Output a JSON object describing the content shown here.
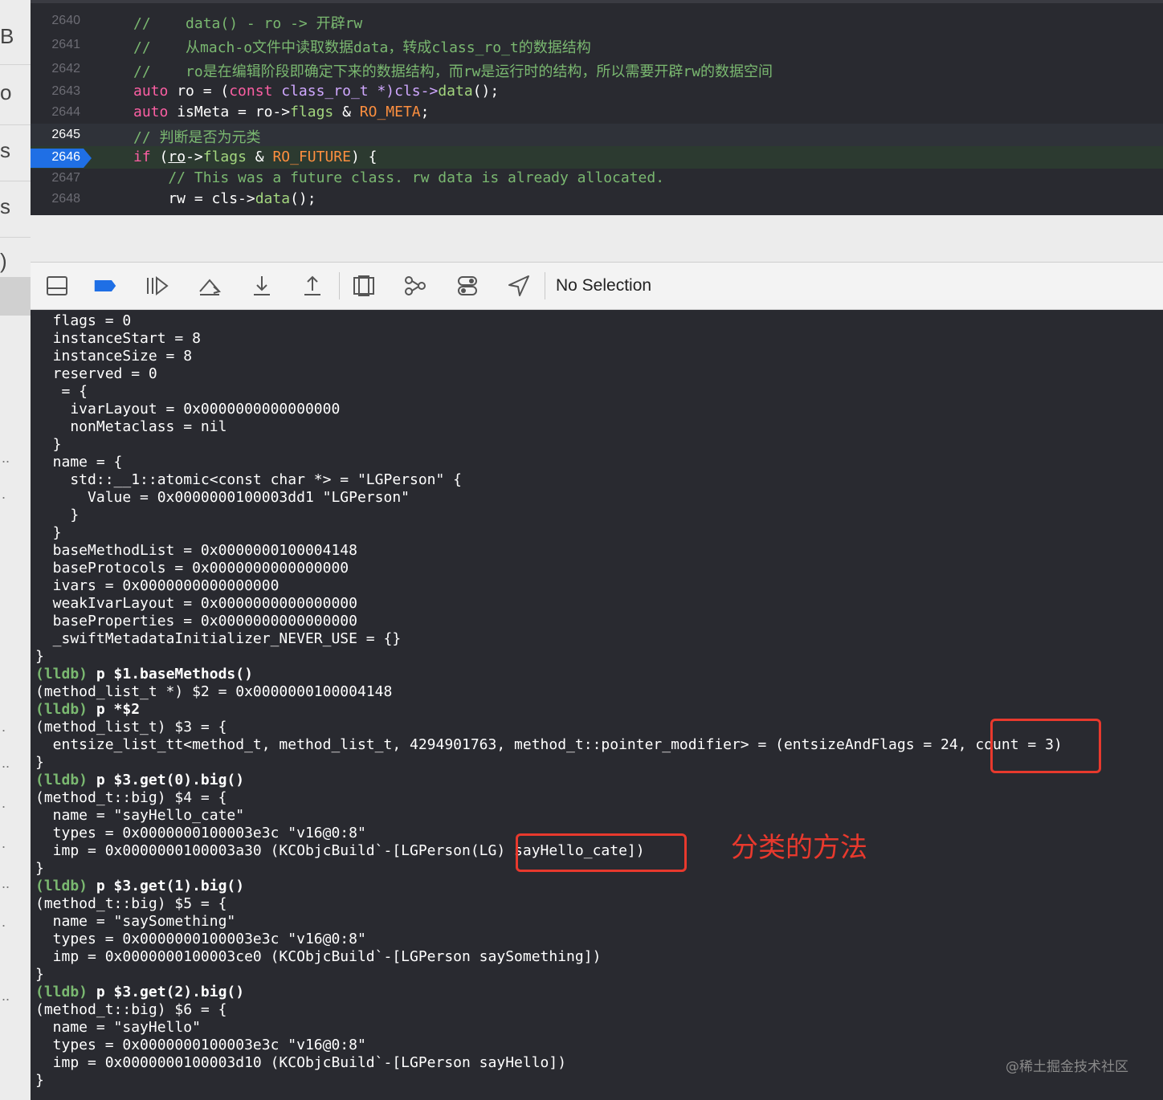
{
  "editor": {
    "lines": [
      {
        "num": "2640",
        "text": "//    data() - ro -> 开辟rw"
      },
      {
        "num": "2641",
        "text": "//    从mach-o文件中读取数据data，转成class_ro_t的数据结构"
      },
      {
        "num": "2642",
        "text": "//    ro是在编辑阶段即确定下来的数据结构，而rw是运行时的结构，所以需要开辟rw的数据空间"
      },
      {
        "num": "2643",
        "kw": "auto",
        "rest1": " ro = (",
        "kw2": "const",
        "rest2": " class_ro_t *)cls->",
        "fn": "data",
        "rest3": "();"
      },
      {
        "num": "2644",
        "kw": "auto",
        "rest1": " isMeta = ro->",
        "fn": "flags",
        "rest2": " & ",
        "macro": "RO_META",
        "rest3": ";"
      },
      {
        "num": "2645",
        "text": "// 判断是否为元类"
      },
      {
        "num": "2646",
        "kw": "if",
        "rest1": " (",
        "ul": "ro",
        "rest2": "->",
        "fn": "flags",
        "rest3": " & ",
        "macro": "RO_FUTURE",
        "rest4": ") {"
      },
      {
        "num": "2647",
        "text": "    // This was a future class. rw data is already allocated."
      },
      {
        "num": "2648",
        "plain": "    rw = cls->",
        "fn": "data",
        "rest": "();"
      }
    ]
  },
  "toolbar": {
    "no_selection": "No Selection",
    "icons": [
      "hide-console-icon",
      "breakpoint-toggle-icon",
      "continue-icon",
      "step-over-icon",
      "step-into-icon",
      "step-out-icon",
      "view-hierarchy-icon",
      "memory-graph-icon",
      "environment-overrides-icon",
      "simulate-location-icon"
    ]
  },
  "console": {
    "lines": [
      "  flags = 0",
      "  instanceStart = 8",
      "  instanceSize = 8",
      "  reserved = 0",
      "   = {",
      "    ivarLayout = 0x0000000000000000",
      "    nonMetaclass = nil",
      "  }",
      "  name = {",
      "    std::__1::atomic<const char *> = \"LGPerson\" {",
      "      Value = 0x0000000100003dd1 \"LGPerson\"",
      "    }",
      "  }",
      "  baseMethodList = 0x0000000100004148",
      "  baseProtocols = 0x0000000000000000",
      "  ivars = 0x0000000000000000",
      "  weakIvarLayout = 0x0000000000000000",
      "  baseProperties = 0x0000000000000000",
      "  _swiftMetadataInitializer_NEVER_USE = {}",
      "}",
      {
        "prompt": "(lldb)",
        "cmd": " p $1.baseMethods()"
      },
      "(method_list_t *) $2 = 0x0000000100004148",
      {
        "prompt": "(lldb)",
        "cmd": " p *$2"
      },
      "(method_list_t) $3 = {",
      "  entsize_list_tt<method_t, method_list_t, 4294901763, method_t::pointer_modifier> = (entsizeAndFlags = 24, count = 3)",
      "}",
      {
        "prompt": "(lldb)",
        "cmd": " p $3.get(0).big()"
      },
      "(method_t::big) $4 = {",
      "  name = \"sayHello_cate\"",
      "  types = 0x0000000100003e3c \"v16@0:8\"",
      "  imp = 0x0000000100003a30 (KCObjcBuild`-[LGPerson(LG) sayHello_cate])",
      "}",
      {
        "prompt": "(lldb)",
        "cmd": " p $3.get(1).big()"
      },
      "(method_t::big) $5 = {",
      "  name = \"saySomething\"",
      "  types = 0x0000000100003e3c \"v16@0:8\"",
      "  imp = 0x0000000100003ce0 (KCObjcBuild`-[LGPerson saySomething])",
      "}",
      {
        "prompt": "(lldb)",
        "cmd": " p $3.get(2).big()"
      },
      "(method_t::big) $6 = {",
      "  name = \"sayHello\"",
      "  types = 0x0000000100003e3c \"v16@0:8\"",
      "  imp = 0x0000000100003d10 (KCObjcBuild`-[LGPerson sayHello])",
      "}"
    ],
    "annotation": "分类的方法",
    "watermark": "@稀土掘金技术社区"
  },
  "colors": {
    "highlight": "#e8392d",
    "comment": "#7ab870",
    "keyword": "#fc5fa3",
    "background": "#292a30",
    "current_line_badge": "#1f6fe5"
  }
}
